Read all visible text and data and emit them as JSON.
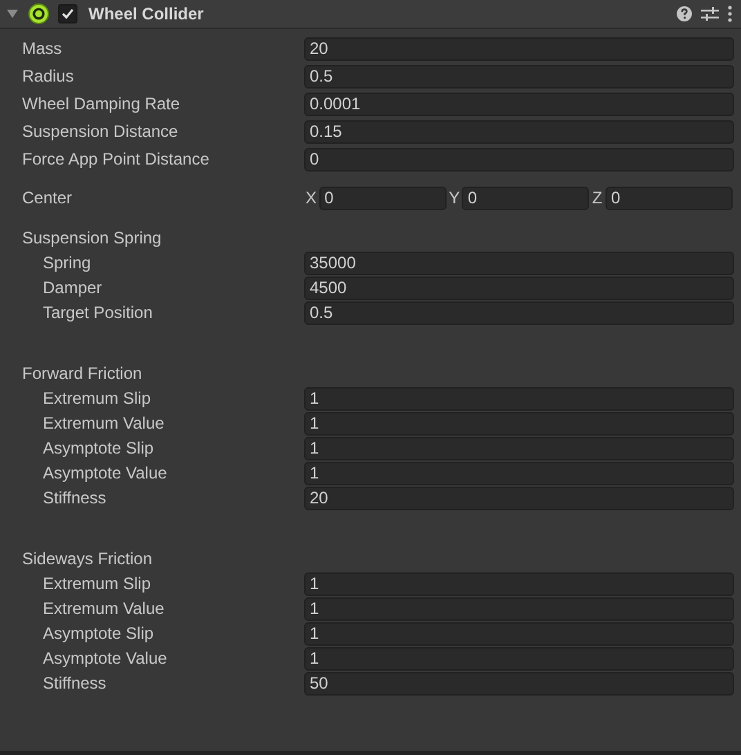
{
  "header": {
    "title": "Wheel Collider",
    "expanded": true,
    "enabled": true
  },
  "fields": [
    {
      "label": "Mass",
      "value": "20"
    },
    {
      "label": "Radius",
      "value": "0.5"
    },
    {
      "label": "Wheel Damping Rate",
      "value": "0.0001"
    },
    {
      "label": "Suspension Distance",
      "value": "0.15"
    },
    {
      "label": "Force App Point Distance",
      "value": "0"
    }
  ],
  "center": {
    "label": "Center",
    "axes": [
      {
        "label": "X",
        "value": "0"
      },
      {
        "label": "Y",
        "value": "0"
      },
      {
        "label": "Z",
        "value": "0"
      }
    ]
  },
  "groups": [
    {
      "title": "Suspension Spring",
      "fields": [
        {
          "label": "Spring",
          "value": "35000"
        },
        {
          "label": "Damper",
          "value": "4500"
        },
        {
          "label": "Target Position",
          "value": "0.5"
        }
      ]
    },
    {
      "title": "Forward Friction",
      "fields": [
        {
          "label": "Extremum Slip",
          "value": "1"
        },
        {
          "label": "Extremum Value",
          "value": "1"
        },
        {
          "label": "Asymptote Slip",
          "value": "1"
        },
        {
          "label": "Asymptote Value",
          "value": "1"
        },
        {
          "label": "Stiffness",
          "value": "20"
        }
      ]
    },
    {
      "title": "Sideways Friction",
      "fields": [
        {
          "label": "Extremum Slip",
          "value": "1"
        },
        {
          "label": "Extremum Value",
          "value": "1"
        },
        {
          "label": "Asymptote Slip",
          "value": "1"
        },
        {
          "label": "Asymptote Value",
          "value": "1"
        },
        {
          "label": "Stiffness",
          "value": "50"
        }
      ]
    }
  ]
}
